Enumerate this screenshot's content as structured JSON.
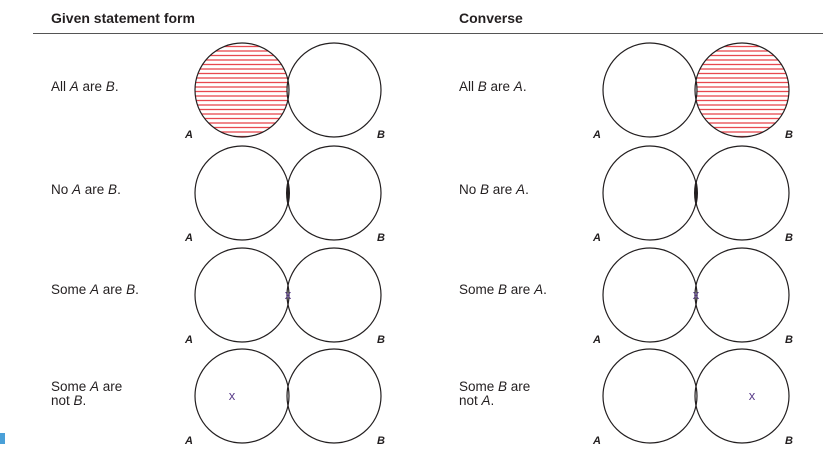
{
  "headers": {
    "given": "Given statement form",
    "converse": "Converse"
  },
  "rows": [
    {
      "given": {
        "statement_html": "All <i>A</i> are <i>B</i>.",
        "shade": "left-only",
        "x_mark": null
      },
      "converse": {
        "statement_html": "All <i>B</i> are <i>A</i>.",
        "shade": "right-only",
        "x_mark": null
      }
    },
    {
      "given": {
        "statement_html": "No <i>A</i> are <i>B</i>.",
        "shade": "intersection",
        "x_mark": null
      },
      "converse": {
        "statement_html": "No <i>B</i> are <i>A</i>.",
        "shade": "intersection",
        "x_mark": null
      }
    },
    {
      "given": {
        "statement_html": "Some <i>A</i> are <i>B</i>.",
        "shade": null,
        "x_mark": "intersection"
      },
      "converse": {
        "statement_html": "Some <i>B</i> are <i>A</i>.",
        "shade": null,
        "x_mark": "intersection"
      }
    },
    {
      "given": {
        "statement_html": "Some <i>A</i> are\nnot <i>B</i>.",
        "shade": null,
        "x_mark": "left-only"
      },
      "converse": {
        "statement_html": "Some <i>B</i> are\nnot <i>A</i>.",
        "shade": null,
        "x_mark": "right-only"
      }
    }
  ],
  "circle_labels": {
    "left": "A",
    "right": "B"
  },
  "x_symbol": "x",
  "colors": {
    "shade_stripe": "#e8484f",
    "outline": "#231f20",
    "x_mark": "#5a3d8a"
  }
}
